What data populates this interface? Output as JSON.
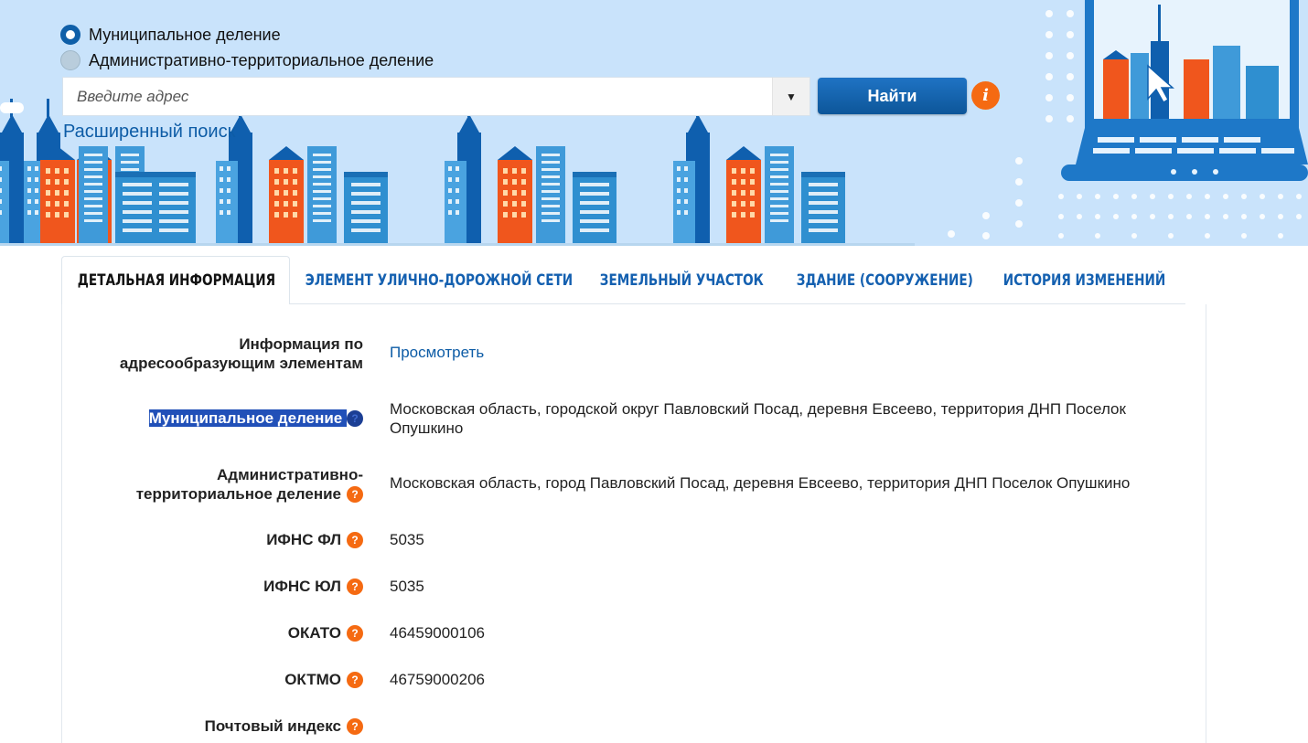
{
  "search": {
    "radio_municipal": "Муниципальное деление",
    "radio_admin": "Административно-территориальное деление",
    "placeholder": "Введите адрес",
    "dropdown_glyph": "▼",
    "find_label": "Найти",
    "info_glyph": "i",
    "advanced_label": "Расширенный поиск"
  },
  "tabs": [
    {
      "label": "ДЕТАЛЬНАЯ ИНФОРМАЦИЯ",
      "active": true
    },
    {
      "label": "ЭЛЕМЕНТ УЛИЧНО-ДОРОЖНОЙ СЕТИ",
      "active": false
    },
    {
      "label": "ЗЕМЕЛЬНЫЙ УЧАСТОК",
      "active": false
    },
    {
      "label": "ЗДАНИЕ (СООРУЖЕНИЕ)",
      "active": false
    },
    {
      "label": "ИСТОРИЯ ИЗМЕНЕНИЙ",
      "active": false
    }
  ],
  "details": {
    "addr_elements": {
      "label_line1": "Информация по",
      "label_line2": "адресообразующим элементам",
      "link": "Просмотреть"
    },
    "municipal": {
      "label": "Муниципальное деление",
      "value": "Московская область, городской округ Павловский Посад, деревня Евсеево, территория ДНП Поселок Опушкино"
    },
    "admin": {
      "label_line1": "Административно-",
      "label_line2": "территориальное деление",
      "value": "Московская область, город Павловский Посад, деревня Евсеево, территория ДНП Поселок Опушкино"
    },
    "ifns_fl": {
      "label": "ИФНС ФЛ",
      "value": "5035"
    },
    "ifns_ul": {
      "label": "ИФНС ЮЛ",
      "value": "5035"
    },
    "okato": {
      "label": "ОКАТО",
      "value": "46459000106"
    },
    "oktmo": {
      "label": "ОКТМО",
      "value": "46759000206"
    },
    "postal": {
      "label": "Почтовый индекс",
      "value": ""
    }
  },
  "help_glyph": "?",
  "colors": {
    "accent_blue": "#0d5ca6",
    "button_blue": "#1464b4",
    "help_orange": "#f56a12",
    "banner_bg": "#c9e3fb"
  }
}
